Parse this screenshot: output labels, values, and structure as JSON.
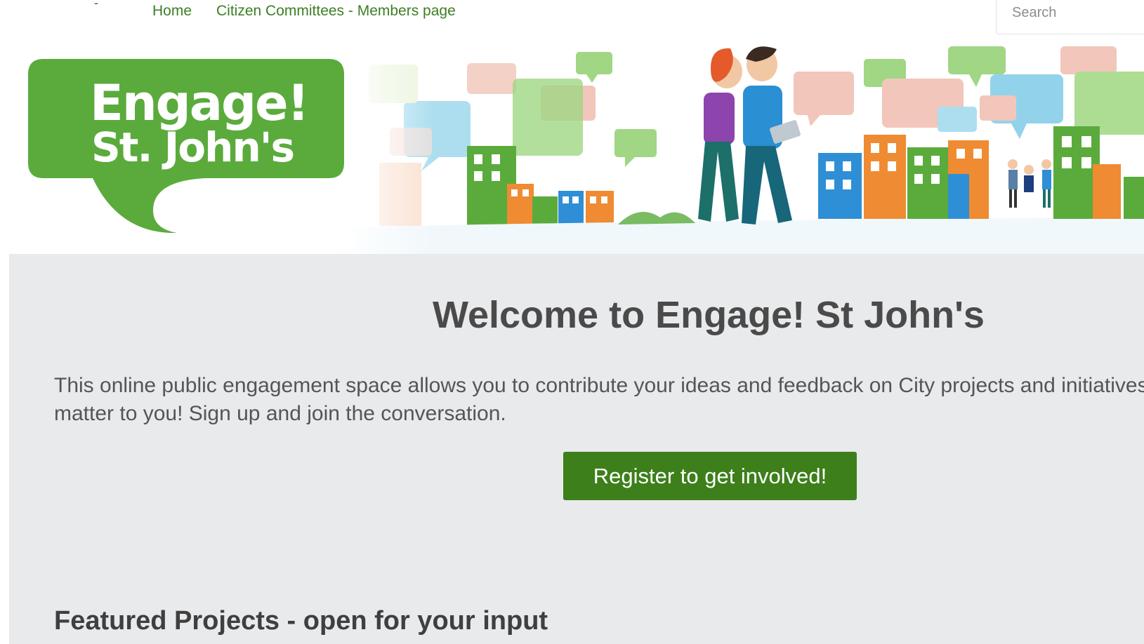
{
  "nav": {
    "dash": "-",
    "links": [
      "Home",
      "Citizen Committees - Members page"
    ],
    "search_placeholder": "Search"
  },
  "banner": {
    "logo_line1": "Engage!",
    "logo_line2": "St. John's"
  },
  "main": {
    "title": "Welcome to Engage! St John's",
    "intro": "This online public engagement space allows you to contribute your ideas and feedback on City projects and initiatives that matter to you! Sign up and join the conversation.",
    "register_label": "Register to get involved!",
    "featured_heading": "Featured Projects - open for your input"
  },
  "colors": {
    "brand_green": "#5aab3c",
    "button_green": "#3d7f1a",
    "nav_link": "#3d7f24",
    "main_bg": "#e9eaec"
  }
}
